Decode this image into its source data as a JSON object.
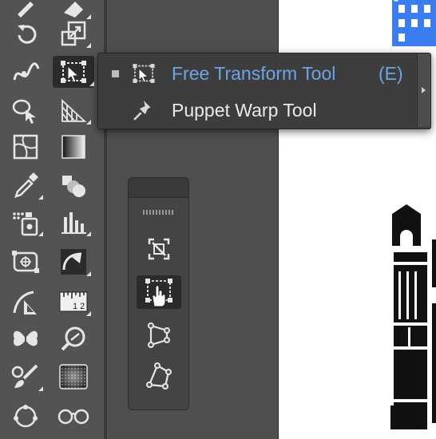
{
  "flyout": {
    "items": [
      {
        "label": "Free Transform Tool",
        "shortcut": "(E)",
        "icon": "free-transform-icon",
        "selected": true
      },
      {
        "label": "Puppet Warp Tool",
        "shortcut": "",
        "icon": "pin-icon",
        "selected": false
      }
    ]
  },
  "toolbar": {
    "tools": [
      "pencil-icon",
      "eraser-icon",
      "rotate-icon",
      "scale-icon",
      "width-icon",
      "free-transform-icon",
      "shape-builder-icon",
      "perspective-grid-icon",
      "mesh-icon",
      "gradient-icon",
      "eyedropper-icon",
      "blend-icon",
      "symbol-sprayer-icon",
      "column-graph-icon",
      "artboard-icon",
      "slice-icon",
      "measure-icon",
      "ruler-icon",
      "symbol-icon",
      "search-icon",
      "paintbrush-icon",
      "texture-icon",
      "lasso-icon",
      "glasses-icon"
    ],
    "ruler_label": "1 2"
  },
  "floating_panel": {
    "tools": [
      "constrain-icon",
      "free-transform-hand-icon",
      "perspective-distort-icon",
      "free-distort-icon"
    ]
  },
  "colors": {
    "accent": "#6fa3e8",
    "selection": "#3b7df0",
    "toolbar_bg": "#535353",
    "canvas_bg": "#ffffff"
  }
}
